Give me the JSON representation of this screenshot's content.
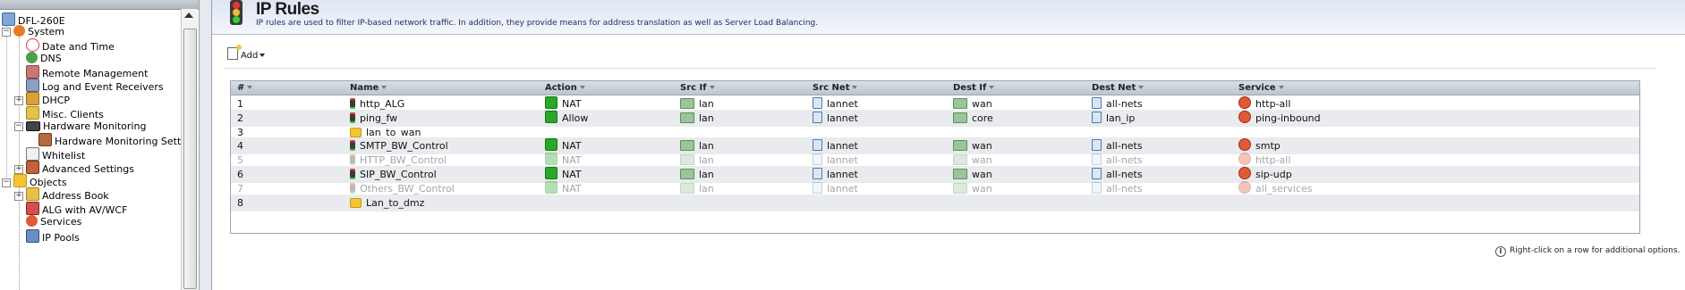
{
  "tree": {
    "root": "DFL-260E",
    "items": [
      {
        "label": "System",
        "icon": "system-icon"
      },
      {
        "label": "Date and Time",
        "icon": "clock-icon"
      },
      {
        "label": "DNS",
        "icon": "dns-icon"
      },
      {
        "label": "Remote Management",
        "icon": "remote-management-icon"
      },
      {
        "label": "Log and Event Receivers",
        "icon": "log-icon"
      },
      {
        "label": "DHCP",
        "icon": "dhcp-icon"
      },
      {
        "label": "Misc. Clients",
        "icon": "misc-clients-icon"
      },
      {
        "label": "Hardware Monitoring",
        "icon": "hardware-monitoring-icon"
      },
      {
        "label": "Hardware Monitoring Setting",
        "icon": "hardware-setting-icon"
      },
      {
        "label": "Whitelist",
        "icon": "whitelist-icon"
      },
      {
        "label": "Advanced Settings",
        "icon": "advanced-settings-icon"
      },
      {
        "label": "Objects",
        "icon": "folder-icon"
      },
      {
        "label": "Address Book",
        "icon": "address-book-icon"
      },
      {
        "label": "ALG with AV/WCF",
        "icon": "alg-icon"
      },
      {
        "label": "Services",
        "icon": "services-icon"
      },
      {
        "label": "IP Pools",
        "icon": "ip-pools-icon"
      }
    ]
  },
  "header": {
    "title": "IP Rules",
    "description": "IP rules are used to filter IP-based network traffic. In addition, they provide means for address translation as well as Server Load Balancing."
  },
  "toolbar": {
    "add_label": "Add"
  },
  "table": {
    "columns": [
      "#",
      "Name",
      "Action",
      "Src If",
      "Src Net",
      "Dest If",
      "Dest Net",
      "Service"
    ],
    "rows": [
      {
        "num": "1",
        "name": "http_ALG",
        "type": "rule",
        "action": "NAT",
        "src_if": "lan",
        "src_net": "lannet",
        "dest_if": "wan",
        "dest_net": "all-nets",
        "service": "http-all",
        "disabled": false
      },
      {
        "num": "2",
        "name": "ping_fw",
        "type": "rule",
        "action": "Allow",
        "src_if": "lan",
        "src_net": "lannet",
        "dest_if": "core",
        "dest_net": "lan_ip",
        "service": "ping-inbound",
        "disabled": false
      },
      {
        "num": "3",
        "name": "lan_to_wan",
        "type": "folder",
        "action": "",
        "src_if": "",
        "src_net": "",
        "dest_if": "",
        "dest_net": "",
        "service": "",
        "disabled": false
      },
      {
        "num": "4",
        "name": "SMTP_BW_Control",
        "type": "rule",
        "action": "NAT",
        "src_if": "lan",
        "src_net": "lannet",
        "dest_if": "wan",
        "dest_net": "all-nets",
        "service": "smtp",
        "disabled": false
      },
      {
        "num": "5",
        "name": "HTTP_BW_Control",
        "type": "rule",
        "action": "NAT",
        "src_if": "lan",
        "src_net": "lannet",
        "dest_if": "wan",
        "dest_net": "all-nets",
        "service": "http-all",
        "disabled": true
      },
      {
        "num": "6",
        "name": "SIP_BW_Control",
        "type": "rule",
        "action": "NAT",
        "src_if": "lan",
        "src_net": "lannet",
        "dest_if": "wan",
        "dest_net": "all-nets",
        "service": "sip-udp",
        "disabled": false
      },
      {
        "num": "7",
        "name": "Others_BW_Control",
        "type": "rule",
        "action": "NAT",
        "src_if": "lan",
        "src_net": "lannet",
        "dest_if": "wan",
        "dest_net": "all-nets",
        "service": "all_services",
        "disabled": true
      },
      {
        "num": "8",
        "name": "Lan_to_dmz",
        "type": "folder",
        "action": "",
        "src_if": "",
        "src_net": "",
        "dest_if": "",
        "dest_net": "",
        "service": "",
        "disabled": false
      }
    ]
  },
  "hint": "Right-click on a row for additional options.",
  "colors": {
    "header_bg": "#dfe6f2",
    "row_alt": "#e9ebee",
    "disabled_text": "#a6a6a6",
    "nat_green": "#2aa62a"
  }
}
